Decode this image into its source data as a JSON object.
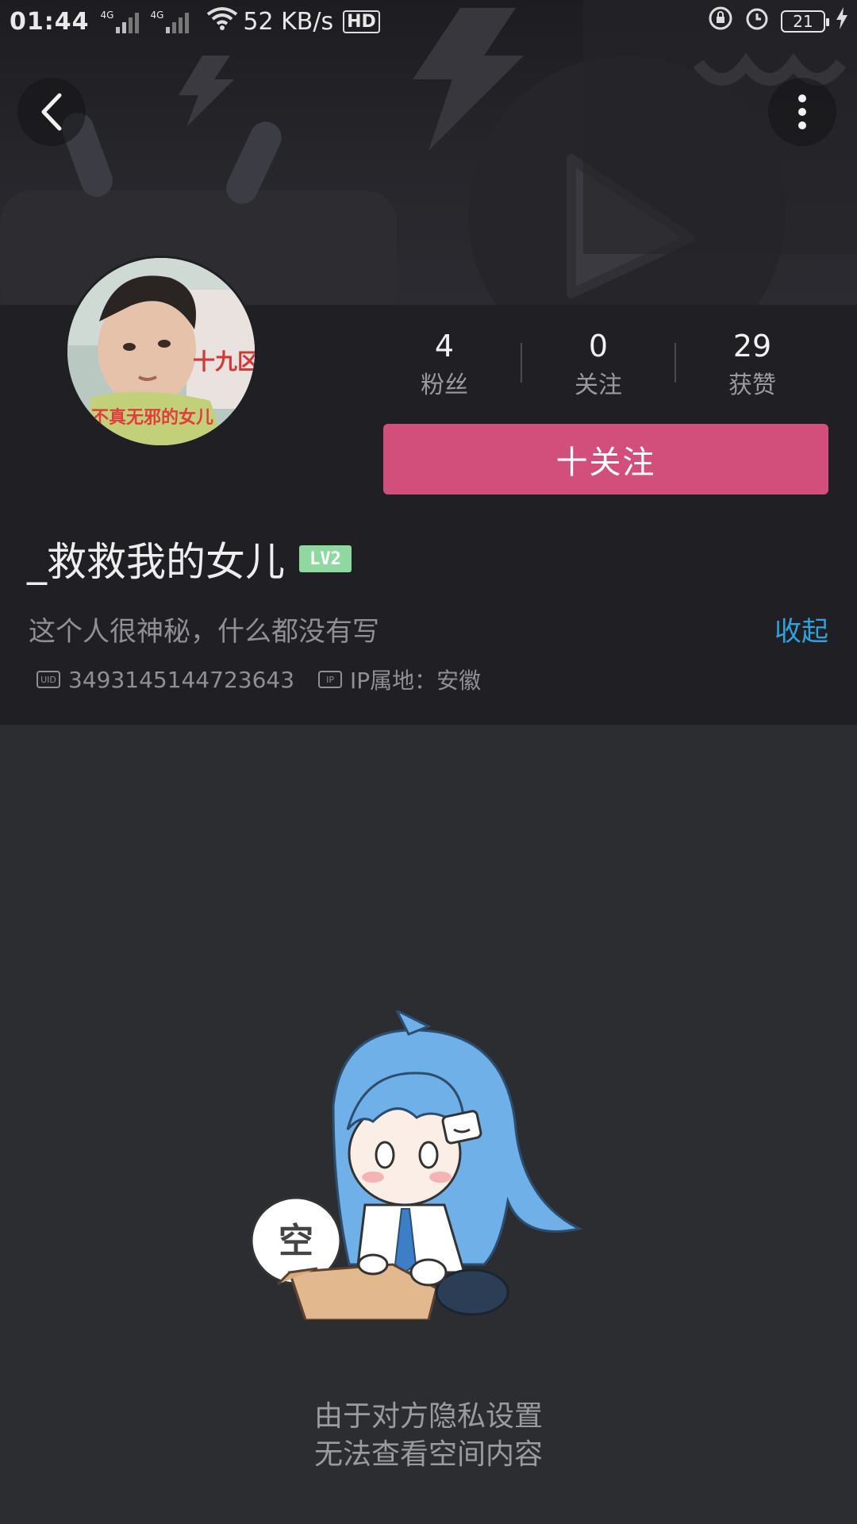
{
  "status_bar": {
    "time": "01:44",
    "net1": "4G",
    "net2": "4G",
    "speed": "52 KB/s",
    "hd": "HD",
    "battery": "21"
  },
  "header": {
    "back_icon": "chevron-left-icon",
    "more_icon": "more-vertical-icon"
  },
  "profile": {
    "stats": [
      {
        "value": "4",
        "label": "粉丝"
      },
      {
        "value": "0",
        "label": "关注"
      },
      {
        "value": "29",
        "label": "获赞"
      }
    ],
    "follow_label": "十关注",
    "username": "_救救我的女儿",
    "level": "LV2",
    "bio": "这个人很神秘，什么都没有写",
    "collapse_label": "收起",
    "uid_tag": "UID",
    "uid": "3493145144723643",
    "ip_tag": "IP",
    "ip_location": "IP属地：安徽"
  },
  "avatar_texts": {
    "a": "十九区",
    "b": "不真无邪的女儿"
  },
  "empty_state": {
    "bubble": "空",
    "line1": "由于对方隐私设置",
    "line2": "无法查看空间内容"
  },
  "colors": {
    "accent_pink": "#d34f7b",
    "link_blue": "#2fa3dd",
    "level_green": "#8fd9a0"
  }
}
